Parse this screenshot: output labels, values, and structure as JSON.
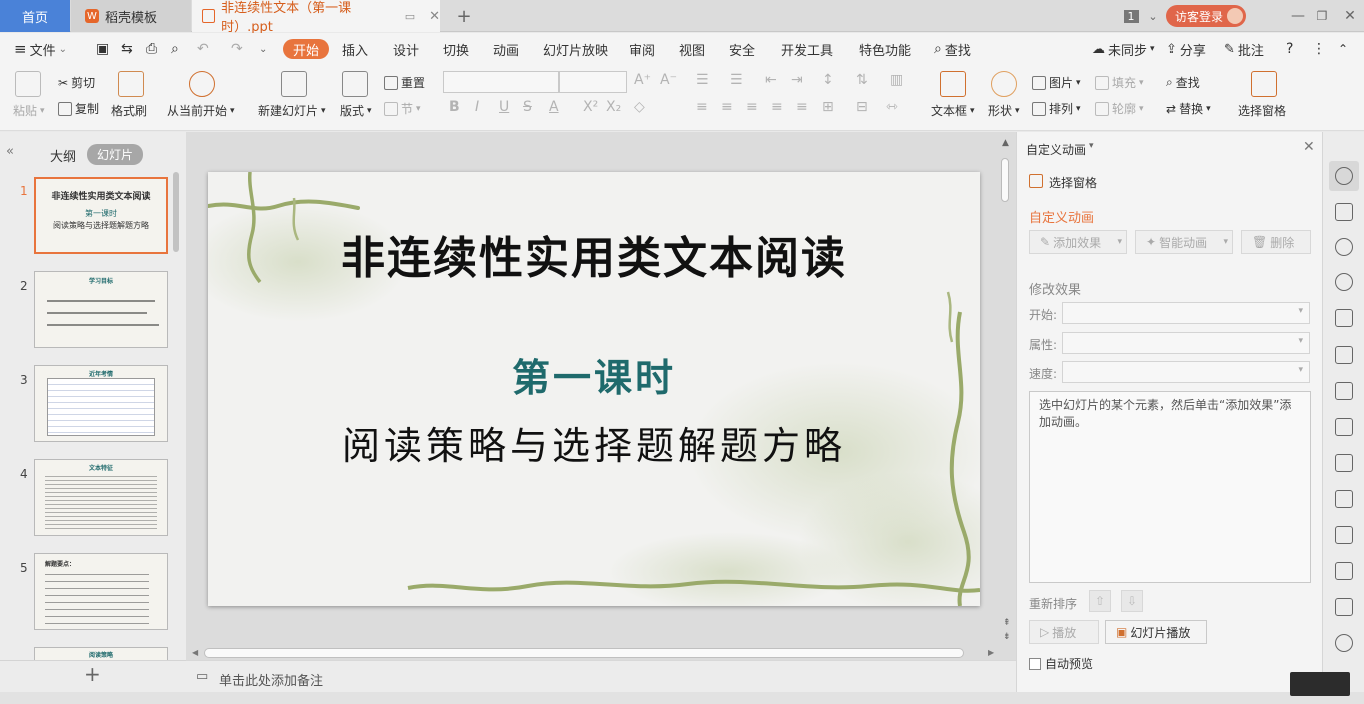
{
  "titlebar": {
    "tab_home": "首页",
    "tab_template": "稻壳模板",
    "tab_document": "非连续性文本（第一课时）.ppt",
    "window_count": "1",
    "login": "访客登录"
  },
  "menu": {
    "file": "文件",
    "items": [
      "开始",
      "插入",
      "设计",
      "切换",
      "动画",
      "幻灯片放映",
      "审阅",
      "视图",
      "安全",
      "开发工具",
      "特色功能"
    ],
    "search": "查找",
    "sync": "未同步",
    "share": "分享",
    "comment": "批注"
  },
  "ribbon": {
    "paste": "粘贴",
    "cut": "剪切",
    "copy": "复制",
    "format_painter": "格式刷",
    "from_current": "从当前开始",
    "new_slide": "新建幻灯片",
    "layout": "版式",
    "reset": "重置",
    "section": "节",
    "textbox": "文本框",
    "shape": "形状",
    "picture": "图片",
    "fill": "填充",
    "arrange": "排列",
    "outline": "轮廓",
    "find": "查找",
    "replace": "替换",
    "selection_pane": "选择窗格"
  },
  "left_pane": {
    "tab_outline": "大纲",
    "tab_slides": "幻灯片",
    "thumbs": [
      {
        "num": "1",
        "title": "非连续性实用类文本阅读",
        "sub1": "第一课时",
        "sub2": "阅读策略与选择题解题方略"
      },
      {
        "num": "2",
        "title": "学习目标"
      },
      {
        "num": "3",
        "title": "近年考情"
      },
      {
        "num": "4",
        "title": "文本特征"
      },
      {
        "num": "5",
        "title": "解题要点："
      },
      {
        "num": "6",
        "title": "阅读策略"
      }
    ]
  },
  "slide": {
    "title": "非连续性实用类文本阅读",
    "subtitle1": "第一课时",
    "subtitle2": "阅读策略与选择题解题方略"
  },
  "notes": {
    "placeholder": "单击此处添加备注"
  },
  "anim_pane": {
    "header": "自定义动画",
    "selection_pane": "选择窗格",
    "section_title": "自定义动画",
    "add_effect": "添加效果",
    "smart_anim": "智能动画",
    "delete": "删除",
    "modify": "修改效果",
    "start_label": "开始:",
    "property_label": "属性:",
    "speed_label": "速度:",
    "hint": "选中幻灯片的某个元素，然后单击“添加效果”添加动画。",
    "reorder": "重新排序",
    "play": "播放",
    "slideshow": "幻灯片播放",
    "autopreview": "自动预览"
  },
  "colors": {
    "accent": "#e8743d",
    "home_tab": "#4a82d8",
    "subtitle_teal": "#1f6a6c",
    "vine_green": "#9aaa6a"
  }
}
